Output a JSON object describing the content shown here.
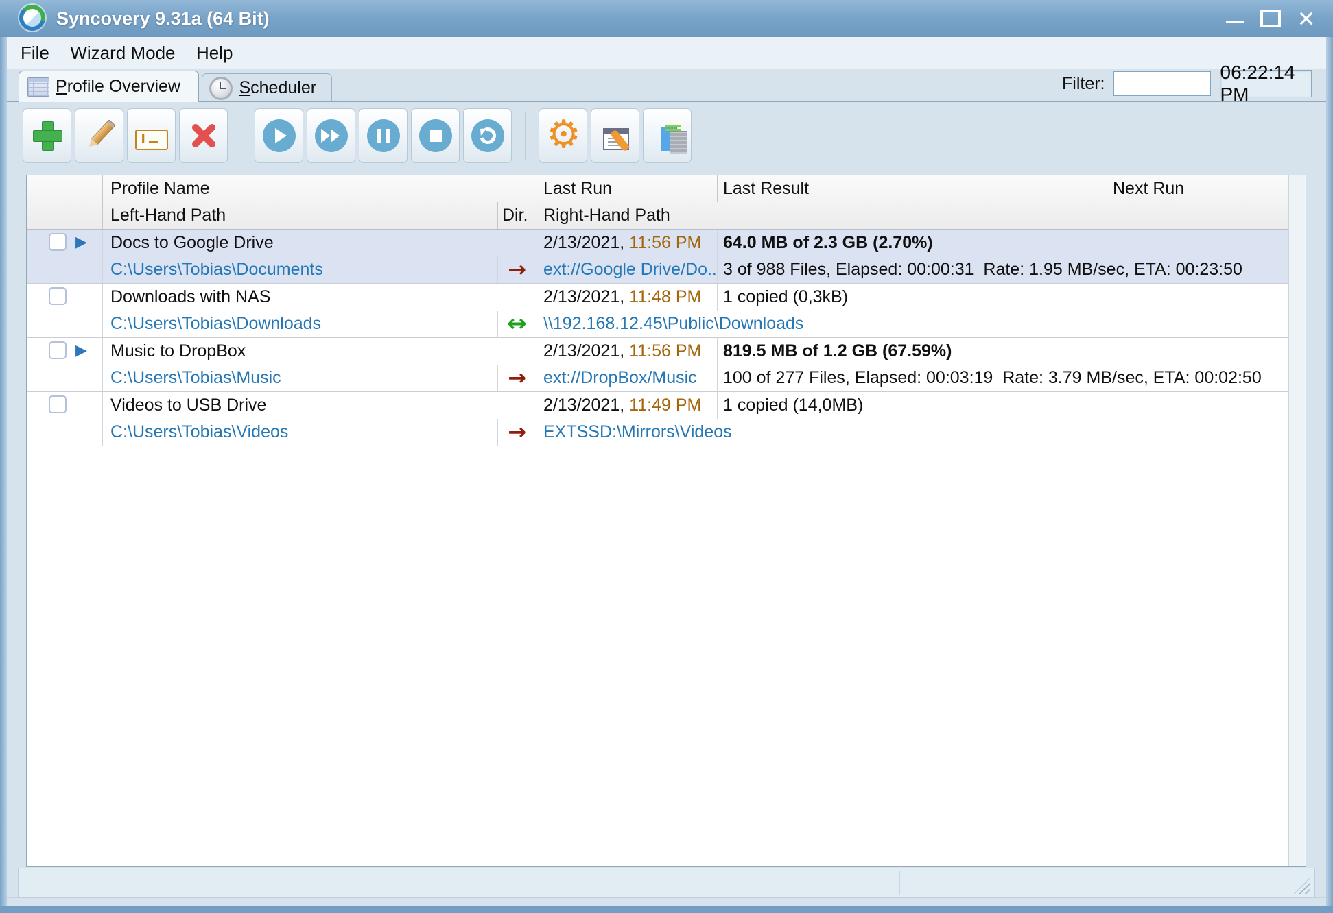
{
  "window": {
    "title": "Syncovery 9.31a (64 Bit)",
    "clock": "06:22:14 PM"
  },
  "menu": {
    "items": [
      "File",
      "Wizard Mode",
      "Help"
    ]
  },
  "tabs": {
    "profile_overview": "Profile Overview",
    "scheduler": "Scheduler"
  },
  "filter": {
    "label": "Filter:",
    "value": ""
  },
  "toolbar": {
    "groups": [
      [
        {
          "name": "add-profile",
          "icon": "plus-icon"
        },
        {
          "name": "edit-profile",
          "icon": "pencil-icon"
        },
        {
          "name": "rename-profile",
          "icon": "rename-icon"
        },
        {
          "name": "delete-profile",
          "icon": "red-x-icon"
        }
      ],
      [
        {
          "name": "run-profile",
          "icon": "play-icon"
        },
        {
          "name": "run-multiple",
          "icon": "fast-forward-icon"
        },
        {
          "name": "pause-profile",
          "icon": "pause-icon"
        },
        {
          "name": "stop-profile",
          "icon": "stop-icon"
        },
        {
          "name": "restart-profile",
          "icon": "restart-icon"
        }
      ],
      [
        {
          "name": "program-settings",
          "icon": "gear-icon"
        },
        {
          "name": "profile-tools",
          "icon": "window-wrench-icon"
        },
        {
          "name": "view-logs",
          "icon": "log-files-icon"
        }
      ]
    ]
  },
  "table": {
    "headers": {
      "profile_name": "Profile Name",
      "last_run": "Last Run",
      "last_result": "Last Result",
      "next_run": "Next Run",
      "left_hand_path": "Left-Hand Path",
      "dir": "Dir.",
      "right_hand_path": "Right-Hand Path"
    },
    "rows": [
      {
        "selected": true,
        "checked": false,
        "running": true,
        "profile_name": "Docs to Google Drive",
        "left_path": "C:\\Users\\Tobias\\Documents",
        "direction": "right",
        "right_path": "ext://Google Drive/Do...",
        "last_run_date": "2/13/2021,",
        "last_run_time": "11:56 PM",
        "result_primary": "64.0 MB of 2.3 GB (2.70%)",
        "result_primary_bold": true,
        "result_detail": "3 of 988 Files, Elapsed: 00:00:31  Rate: 1.95 MB/sec, ETA: 00:23:50"
      },
      {
        "selected": false,
        "checked": false,
        "running": false,
        "profile_name": "Downloads with NAS",
        "left_path": "C:\\Users\\Tobias\\Downloads",
        "direction": "both",
        "right_path": "\\\\192.168.12.45\\Public\\Downloads",
        "last_run_date": "2/13/2021,",
        "last_run_time": "11:48 PM",
        "result_primary": "1 copied (0,3kB)",
        "result_primary_bold": false,
        "result_detail": ""
      },
      {
        "selected": false,
        "checked": false,
        "running": true,
        "profile_name": "Music to DropBox",
        "left_path": "C:\\Users\\Tobias\\Music",
        "direction": "right",
        "right_path": "ext://DropBox/Music",
        "last_run_date": "2/13/2021,",
        "last_run_time": "11:56 PM",
        "result_primary": "819.5 MB of 1.2 GB (67.59%)",
        "result_primary_bold": true,
        "result_detail": "100 of 277 Files, Elapsed: 00:03:19  Rate: 3.79 MB/sec, ETA: 00:02:50"
      },
      {
        "selected": false,
        "checked": false,
        "running": false,
        "profile_name": "Videos to USB Drive",
        "left_path": "C:\\Users\\Tobias\\Videos",
        "direction": "right",
        "right_path": "EXTSSD:\\Mirrors\\Videos",
        "last_run_date": "2/13/2021,",
        "last_run_time": "11:49 PM",
        "result_primary": "1 copied (14,0MB)",
        "result_primary_bold": false,
        "result_detail": ""
      }
    ]
  },
  "colors": {
    "titlebar": "#7aa5c9",
    "link": "#2577b5",
    "last_run_time": "#a4660a",
    "selected_row": "#dbe2f1",
    "arrow_right": "#8f1f0c",
    "arrow_both": "#1ea31e",
    "running_indicator": "#2d77bc"
  }
}
